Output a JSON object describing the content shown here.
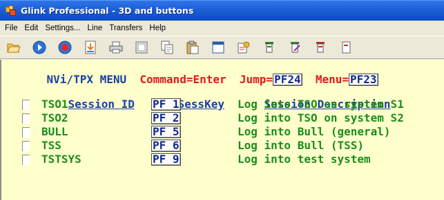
{
  "window": {
    "title": "Glink Professional - 3D and buttons"
  },
  "menubar": {
    "items": [
      "File",
      "Edit",
      "Settings...",
      "Line",
      "Transfers",
      "Help"
    ]
  },
  "toolbar": {
    "icons": [
      "open-folder-icon",
      "play-icon",
      "record-icon",
      "download-icon",
      "print-icon",
      "screen-icon",
      "copy-icon",
      "paste-icon",
      "window-icon",
      "transfer-icon",
      "macro-icon",
      "edit-macro-icon",
      "stop-macro-icon",
      "more-icon"
    ]
  },
  "terminal": {
    "header": {
      "menu_title": "NVi/TPX MENU",
      "command": "Command=Enter",
      "jump_label": "Jump=",
      "jump_key": "PF24",
      "menu_label": "Menu=",
      "menu_key": "PF23"
    },
    "columns": {
      "session_id": "Session ID",
      "sesskey": "SessKey",
      "description": "Session Description"
    },
    "sessions": [
      {
        "id": "TSO1",
        "key": "PF 1",
        "description": "Log into TSO on system S1"
      },
      {
        "id": "TSO2",
        "key": "PF 2",
        "description": "Log into TSO on system S2"
      },
      {
        "id": "BULL",
        "key": "PF 5",
        "description": "Log into Bull (general)"
      },
      {
        "id": "TSS",
        "key": "PF 6",
        "description": "Log into Bull (TSS)"
      },
      {
        "id": "TSTSYS",
        "key": "PF 9",
        "description": "Log into test system"
      }
    ]
  },
  "colors": {
    "terminal_bg": "#ffffcc",
    "header_blue": "#1a3ea8",
    "command_red": "#e21818",
    "row_green": "#1a8d1a",
    "titlebar": "#0b4cc5"
  }
}
